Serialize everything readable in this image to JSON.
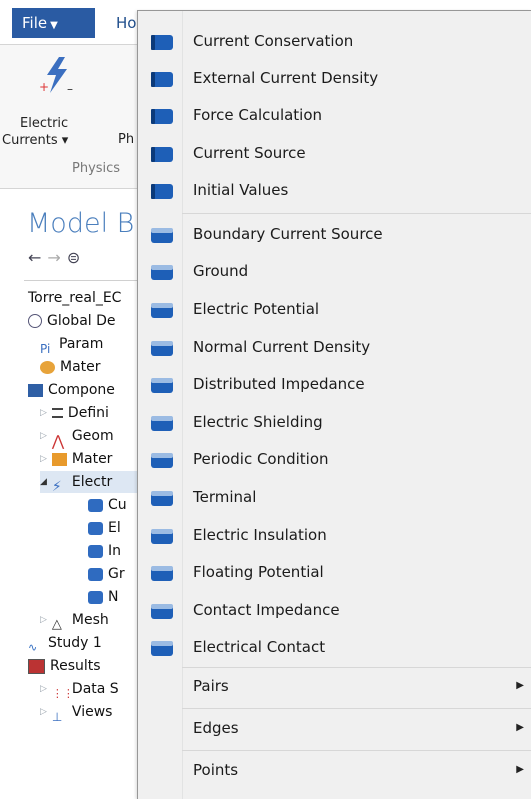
{
  "ribbon": {
    "file_label": "File",
    "home_label": "Ho",
    "electric_line1": "Electric",
    "electric_line2": "Currents ▾",
    "ph_label": "Ph",
    "group_label": "Physics"
  },
  "model_builder": {
    "title": "Model B",
    "tree": [
      {
        "label": "Torre_real_EC"
      },
      {
        "label": "Global De"
      },
      {
        "label": "Param"
      },
      {
        "label": "Mater"
      },
      {
        "label": "Compone"
      },
      {
        "label": "Defini"
      },
      {
        "label": "Geom"
      },
      {
        "label": "Mater"
      },
      {
        "label": "Electr"
      },
      {
        "label": "Cu"
      },
      {
        "label": "El"
      },
      {
        "label": "In"
      },
      {
        "label": "Gr"
      },
      {
        "label": "N"
      },
      {
        "label": "Mesh"
      },
      {
        "label": "Study 1"
      },
      {
        "label": "Results"
      },
      {
        "label": "Data S"
      },
      {
        "label": "Views"
      }
    ]
  },
  "menu": {
    "domain_items": [
      "Current Conservation",
      "External Current Density",
      "Force Calculation",
      "Current Source",
      "Initial Values"
    ],
    "boundary_items": [
      "Boundary Current Source",
      "Ground",
      "Electric Potential",
      "Normal Current Density",
      "Distributed Impedance",
      "Electric Shielding",
      "Periodic Condition",
      "Terminal",
      "Electric Insulation",
      "Floating Potential",
      "Contact Impedance",
      "Electrical Contact"
    ],
    "submenus": [
      {
        "label": "Pairs",
        "arrow": "▶"
      },
      {
        "label": "Edges",
        "arrow": "▶"
      },
      {
        "label": "Points",
        "arrow": "▶"
      }
    ]
  }
}
